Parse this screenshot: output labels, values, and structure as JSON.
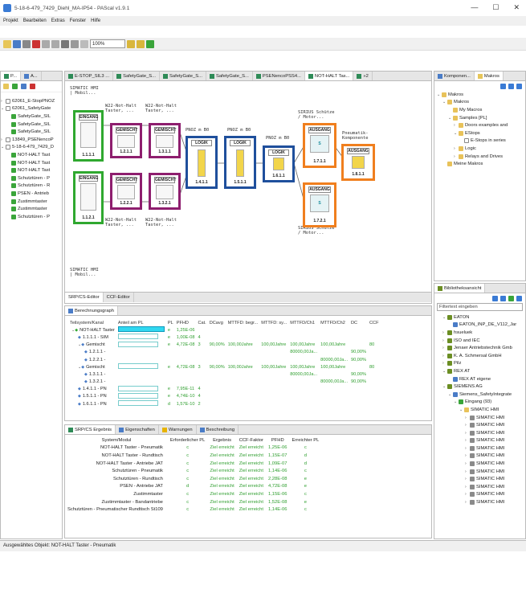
{
  "window": {
    "title": "5-18-6-479_7429_Diehl_MA-IP54 - PAScal v1.9.1",
    "min": "—",
    "max": "☐",
    "close": "✕"
  },
  "menu": [
    "Projekt",
    "Bearbeiten",
    "Extras",
    "Fenster",
    "Hilfe"
  ],
  "toolbar": {
    "zoom": "100%"
  },
  "left_panel": {
    "tabs": [
      "P...",
      "A..."
    ],
    "items": [
      {
        "label": "62061_E-StopPNOZ",
        "indent": 0,
        "icon": "doc",
        "tw": "›"
      },
      {
        "label": "62061_SafetyGate",
        "indent": 0,
        "icon": "doc",
        "tw": "⌄"
      },
      {
        "label": "SafetyGate_SIL",
        "indent": 1,
        "icon": "green"
      },
      {
        "label": "SafetyGate_SIL",
        "indent": 1,
        "icon": "green"
      },
      {
        "label": "SafetyGate_SIL",
        "indent": 1,
        "icon": "green"
      },
      {
        "label": "13849_PSENencoP",
        "indent": 0,
        "icon": "doc",
        "tw": "›"
      },
      {
        "label": "5-18-6-479_7429_D",
        "indent": 0,
        "icon": "doc",
        "tw": "⌄"
      },
      {
        "label": "NOT-HALT Tast",
        "indent": 1,
        "icon": "green"
      },
      {
        "label": "NOT-HALT Tast",
        "indent": 1,
        "icon": "green"
      },
      {
        "label": "NOT-HALT Tast",
        "indent": 1,
        "icon": "green"
      },
      {
        "label": "Schutztüren - P",
        "indent": 1,
        "icon": "green"
      },
      {
        "label": "Schutztüren - R",
        "indent": 1,
        "icon": "green"
      },
      {
        "label": "PSEN - Antrieb",
        "indent": 1,
        "icon": "green"
      },
      {
        "label": "Zustimmtaster",
        "indent": 1,
        "icon": "green"
      },
      {
        "label": "Zustimmtaster",
        "indent": 1,
        "icon": "green"
      },
      {
        "label": "Schutztüren - P",
        "indent": 1,
        "icon": "green"
      }
    ]
  },
  "editor_tabs": [
    "E-STOP_SIL3 ...",
    "SafetyGate_S...",
    "SafetyGate_S...",
    "SafetyGate_S...",
    "PSENencoPSS4...",
    "NOT-HALT Tas...",
    "»2"
  ],
  "diagram": {
    "simatic_top": "SIMATIC HMI\n| Mobil...",
    "simatic_bot": "SIMATIC HMI\n| Mobil...",
    "w22_a_top": "W22-Not-Halt\nTaster, ...",
    "w22_b_top": "W22-Not-Halt\nTaster, ...",
    "w22_a_bot": "W22-Not-Halt\nTaster, ...",
    "w22_b_bot": "W22-Not-Halt\nTaster, ...",
    "pnoz_1": "PNOZ m B0",
    "pnoz_2": "PNOZ m B0",
    "pnoz_3": "PNOZ m B0",
    "sirius_top": "SIRIUS Schütze\n/ Motor...",
    "sirius_bot": "SIRIUS Schütze\n/ Motor...",
    "pneu": "Pneumatik-\nKomponente",
    "blocks": {
      "e1": {
        "hd": "EINGANG",
        "id": "1.1.1.1"
      },
      "e2": {
        "hd": "EINGANG",
        "id": "1.1.2.1"
      },
      "g1": {
        "hd": "GEMISCHT",
        "id": "1.2.1.1"
      },
      "g2": {
        "hd": "GEMISCHT",
        "id": "1.3.1.1"
      },
      "g3": {
        "hd": "GEMISCHT",
        "id": "1.2.2.1"
      },
      "g4": {
        "hd": "GEMISCHT",
        "id": "1.3.2.1"
      },
      "l1": {
        "hd": "LOGIK",
        "id": "1.4.1.1"
      },
      "l2": {
        "hd": "LOGIK",
        "id": "1.5.1.1"
      },
      "l3": {
        "hd": "LOGIK",
        "id": "1.6.1.1"
      },
      "a1": {
        "hd": "AUSGANG",
        "id": "1.7.1.1"
      },
      "a2": {
        "hd": "AUSGANG",
        "id": "1.7.2.1"
      },
      "a3": {
        "hd": "AUSGANG",
        "id": "1.8.1.1"
      }
    }
  },
  "editor_bottom_tabs": [
    "SRP/CS-Editor",
    "CCF-Editor"
  ],
  "calc": {
    "tab": "Berechnungsgraph",
    "headers": [
      "Teilsystem/Kanal",
      "Anteil am PL",
      "PL",
      "PFHD",
      "Cat.",
      "DCavg",
      "MTTFD: begr...",
      "MTTFD: sy...",
      "MTTFD/Ch1",
      "MTTFD/Ch2",
      "DC",
      "CCF"
    ],
    "rows": [
      {
        "name": "NOT-HALT Taster",
        "ind": 0,
        "tw": "⌄",
        "bar": 1,
        "pl": "e",
        "pfh": "1,25E-06",
        "cat": "",
        "dc": "",
        "m1": "",
        "m2": "",
        "ch1": "",
        "ch2": "",
        "dc2": "",
        "ccf": ""
      },
      {
        "name": "1.1.1.1 - SIM",
        "ind": 1,
        "bar": 2,
        "pl": "e",
        "pfh": "1,00E-08",
        "cat": "4",
        "dc": "",
        "m1": "",
        "m2": "",
        "ch1": "",
        "ch2": "",
        "dc2": "",
        "ccf": ""
      },
      {
        "name": "Gemischt",
        "ind": 1,
        "tw": "⌄",
        "bar": 2,
        "pl": "e",
        "pfh": "4,72E-08",
        "cat": "3",
        "dc": "90,00%",
        "m1": "100,00Jahre",
        "m2": "100,00Jahre",
        "ch1": "100,00Jahre",
        "ch2": "100,00Jahre",
        "dc2": "",
        "ccf": "80"
      },
      {
        "name": "1.2.1.1 -",
        "ind": 2,
        "bar": 0,
        "pl": "",
        "pfh": "",
        "cat": "",
        "dc": "",
        "m1": "",
        "m2": "",
        "ch1": "80000,00Ja...",
        "ch2": "",
        "dc2": "90,00%",
        "ccf": ""
      },
      {
        "name": "1.2.2.1 -",
        "ind": 2,
        "bar": 0,
        "pl": "",
        "pfh": "",
        "cat": "",
        "dc": "",
        "m1": "",
        "m2": "",
        "ch1": "",
        "ch2": "80000,00Ja...",
        "dc2": "90,00%",
        "ccf": ""
      },
      {
        "name": "Gemischt",
        "ind": 1,
        "tw": "⌄",
        "bar": 2,
        "pl": "e",
        "pfh": "4,72E-08",
        "cat": "3",
        "dc": "90,00%",
        "m1": "100,00Jahre",
        "m2": "100,00Jahre",
        "ch1": "100,00Jahre",
        "ch2": "100,00Jahre",
        "dc2": "",
        "ccf": "80"
      },
      {
        "name": "1.3.1.1 -",
        "ind": 2,
        "bar": 0,
        "pl": "",
        "pfh": "",
        "cat": "",
        "dc": "",
        "m1": "",
        "m2": "",
        "ch1": "80000,00Ja...",
        "ch2": "",
        "dc2": "90,00%",
        "ccf": ""
      },
      {
        "name": "1.3.2.1 -",
        "ind": 2,
        "bar": 0,
        "pl": "",
        "pfh": "",
        "cat": "",
        "dc": "",
        "m1": "",
        "m2": "",
        "ch1": "",
        "ch2": "80000,00Ja...",
        "dc2": "90,00%",
        "ccf": ""
      },
      {
        "name": "1.4.1.1 - PN",
        "ind": 1,
        "bar": 2,
        "pl": "e",
        "pfh": "7,95E-11",
        "cat": "4",
        "dc": "",
        "m1": "",
        "m2": "",
        "ch1": "",
        "ch2": "",
        "dc2": "",
        "ccf": ""
      },
      {
        "name": "1.5.1.1 - PN",
        "ind": 1,
        "bar": 2,
        "pl": "e",
        "pfh": "4,74E-10",
        "cat": "4",
        "dc": "",
        "m1": "",
        "m2": "",
        "ch1": "",
        "ch2": "",
        "dc2": "",
        "ccf": ""
      },
      {
        "name": "1.6.1.1 - PN",
        "ind": 1,
        "bar": 2,
        "pl": "d",
        "pfh": "1,57E-10",
        "cat": "2",
        "dc": "",
        "m1": "",
        "m2": "",
        "ch1": "",
        "ch2": "",
        "dc2": "",
        "ccf": ""
      }
    ]
  },
  "result": {
    "tabs": [
      "SRP/CS Ergebnis",
      "Eigenschaften",
      "Warnungen",
      "Beschreibung"
    ],
    "headers": [
      "System/Modul",
      "Erforderlicher PL",
      "Ergebnis",
      "CCF-Faktor",
      "PFHD",
      "Erreichter PL"
    ],
    "rows": [
      [
        "NOT-HALT Taster - Pneumatik",
        "c",
        "Ziel erreicht",
        "Ziel erreicht",
        "1,25E-06",
        "c"
      ],
      [
        "NOT-HALT Taster - Rundtisch",
        "c",
        "Ziel erreicht",
        "Ziel erreicht",
        "1,15E-07",
        "d"
      ],
      [
        "NOT-HALT Taster - Antriebe JAT",
        "c",
        "Ziel erreicht",
        "Ziel erreicht",
        "1,09E-07",
        "d"
      ],
      [
        "Schutztüren - Pneumatik",
        "c",
        "Ziel erreicht",
        "Ziel erreicht",
        "1,14E-06",
        "c"
      ],
      [
        "Schutztüren - Rundtisch",
        "c",
        "Ziel erreicht",
        "Ziel erreicht",
        "2,28E-08",
        "e"
      ],
      [
        "PSEN - Antriebe JAT",
        "d",
        "Ziel erreicht",
        "Ziel erreicht",
        "4,72E-08",
        "e"
      ],
      [
        "Zustimmtaster",
        "c",
        "Ziel erreicht",
        "Ziel erreicht",
        "1,15E-06",
        "c"
      ],
      [
        "Zustimmtaster - Bandantriebe",
        "c",
        "Ziel erreicht",
        "Ziel erreicht",
        "1,52E-08",
        "e"
      ],
      [
        "Schutztüren - Pneumatischer Rundtisch St109",
        "c",
        "Ziel erreicht",
        "Ziel erreicht",
        "1,14E-06",
        "c"
      ]
    ]
  },
  "status": "Ausgewähltes Objekt: NOT-HALT Taster - Pneumatik",
  "macros_panel": {
    "tabs": [
      "Komponen...",
      "Makros"
    ],
    "items": [
      {
        "label": "Makros",
        "indent": 0,
        "tw": "⌄",
        "icon": "folder"
      },
      {
        "label": "Makros",
        "indent": 1,
        "tw": "⌄",
        "icon": "folder"
      },
      {
        "label": "My Macros",
        "indent": 2,
        "tw": "",
        "icon": "folder"
      },
      {
        "label": "Samples [PL]",
        "indent": 2,
        "tw": "⌄",
        "icon": "folder"
      },
      {
        "label": "Doors examples and",
        "indent": 3,
        "tw": "›",
        "icon": "folder"
      },
      {
        "label": "EStops",
        "indent": 3,
        "tw": "⌄",
        "icon": "folder"
      },
      {
        "label": "E-Stops in series",
        "indent": 4,
        "tw": "",
        "icon": "doc"
      },
      {
        "label": "Logic",
        "indent": 3,
        "tw": "›",
        "icon": "folder"
      },
      {
        "label": "Relays and Drives",
        "indent": 3,
        "tw": "›",
        "icon": "folder"
      },
      {
        "label": "Meine Makros",
        "indent": 1,
        "tw": "",
        "icon": "folder"
      }
    ]
  },
  "library_panel": {
    "tab": "Bibliotheksansicht",
    "filter_label": "Filtertext eingeben",
    "items": [
      {
        "label": "EATON",
        "indent": 0,
        "tw": "⌄",
        "icon": "book"
      },
      {
        "label": "EATON_INP_DE_V112_Jar",
        "indent": 1,
        "tw": "",
        "icon": "blue"
      },
      {
        "label": "hsueluek",
        "indent": 0,
        "tw": "›",
        "icon": "book"
      },
      {
        "label": "ISO and IEC",
        "indent": 0,
        "tw": "›",
        "icon": "book"
      },
      {
        "label": "Jenaer Antriebstechnik Gmb",
        "indent": 0,
        "tw": "›",
        "icon": "book"
      },
      {
        "label": "K. A. Schmersal GmbH",
        "indent": 0,
        "tw": "›",
        "icon": "book"
      },
      {
        "label": "Pilz",
        "indent": 0,
        "tw": "›",
        "icon": "book"
      },
      {
        "label": "REX AT",
        "indent": 0,
        "tw": "⌄",
        "icon": "book"
      },
      {
        "label": "REX AT eigene",
        "indent": 1,
        "tw": "",
        "icon": "blue"
      },
      {
        "label": "SIEMENS AG",
        "indent": 0,
        "tw": "⌄",
        "icon": "book"
      },
      {
        "label": "Siemens_SafetyIntegrate",
        "indent": 1,
        "tw": "⌄",
        "icon": "blue"
      },
      {
        "label": "Eingang (93)",
        "indent": 2,
        "tw": "⌄",
        "icon": "green"
      },
      {
        "label": "SIMATIC HMI",
        "indent": 3,
        "tw": "⌄",
        "icon": "folder"
      },
      {
        "label": "SIMATIC HMI",
        "indent": 4,
        "tw": "›",
        "icon": "gray"
      },
      {
        "label": "SIMATIC HMI",
        "indent": 4,
        "tw": "›",
        "icon": "gray"
      },
      {
        "label": "SIMATIC HMI",
        "indent": 4,
        "tw": "›",
        "icon": "gray"
      },
      {
        "label": "SIMATIC HMI",
        "indent": 4,
        "tw": "›",
        "icon": "gray"
      },
      {
        "label": "SIMATIC HMI",
        "indent": 4,
        "tw": "›",
        "icon": "gray"
      },
      {
        "label": "SIMATIC HMI",
        "indent": 4,
        "tw": "›",
        "icon": "gray"
      },
      {
        "label": "SIMATIC HMI",
        "indent": 4,
        "tw": "›",
        "icon": "gray"
      },
      {
        "label": "SIMATIC HMI",
        "indent": 4,
        "tw": "›",
        "icon": "gray"
      },
      {
        "label": "SIMATIC HMI",
        "indent": 4,
        "tw": "›",
        "icon": "gray"
      },
      {
        "label": "SIMATIC HMI",
        "indent": 4,
        "tw": "›",
        "icon": "gray"
      },
      {
        "label": "SIMATIC HMI",
        "indent": 4,
        "tw": "›",
        "icon": "gray"
      },
      {
        "label": "SIMATIC HMI",
        "indent": 4,
        "tw": "›",
        "icon": "gray"
      }
    ]
  },
  "colors": {
    "input": "#2fa82f",
    "mixed": "#8e1e6e",
    "logic": "#1f4f9c",
    "output": "#f07f1e",
    "accent_cyan": "#30d8f0"
  }
}
